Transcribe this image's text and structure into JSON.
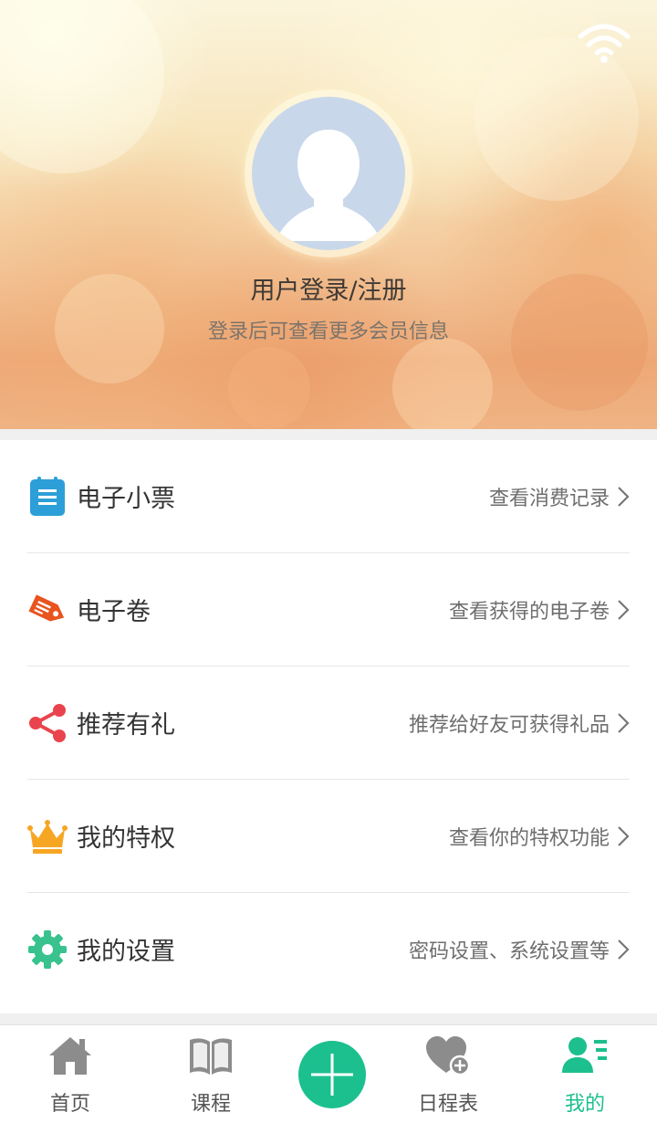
{
  "header": {
    "login_title": "用户登录/注册",
    "login_subtitle": "登录后可查看更多会员信息"
  },
  "menu": {
    "items": [
      {
        "label": "电子小票",
        "desc": "查看消费记录",
        "icon": "receipt-icon",
        "color": "#2d9fd8"
      },
      {
        "label": "电子卷",
        "desc": "查看获得的电子卷",
        "icon": "tag-icon",
        "color": "#e8541e"
      },
      {
        "label": "推荐有礼",
        "desc": "推荐给好友可获得礼品",
        "icon": "share-icon",
        "color": "#e9444d"
      },
      {
        "label": "我的特权",
        "desc": "查看你的特权功能",
        "icon": "crown-icon",
        "color": "#f6a623"
      },
      {
        "label": "我的设置",
        "desc": "密码设置、系统设置等",
        "icon": "gear-icon",
        "color": "#39c28e"
      }
    ]
  },
  "tabbar": {
    "tabs": [
      {
        "label": "首页",
        "icon": "home-icon"
      },
      {
        "label": "课程",
        "icon": "book-icon"
      },
      {
        "label": "日程表",
        "icon": "heart-add-icon"
      },
      {
        "label": "我的",
        "icon": "profile-icon",
        "active": true
      }
    ],
    "fab_icon": "plus-icon"
  },
  "colors": {
    "accent": "#1cc08f",
    "text_primary": "#333333",
    "text_secondary": "#6e6e6e"
  }
}
